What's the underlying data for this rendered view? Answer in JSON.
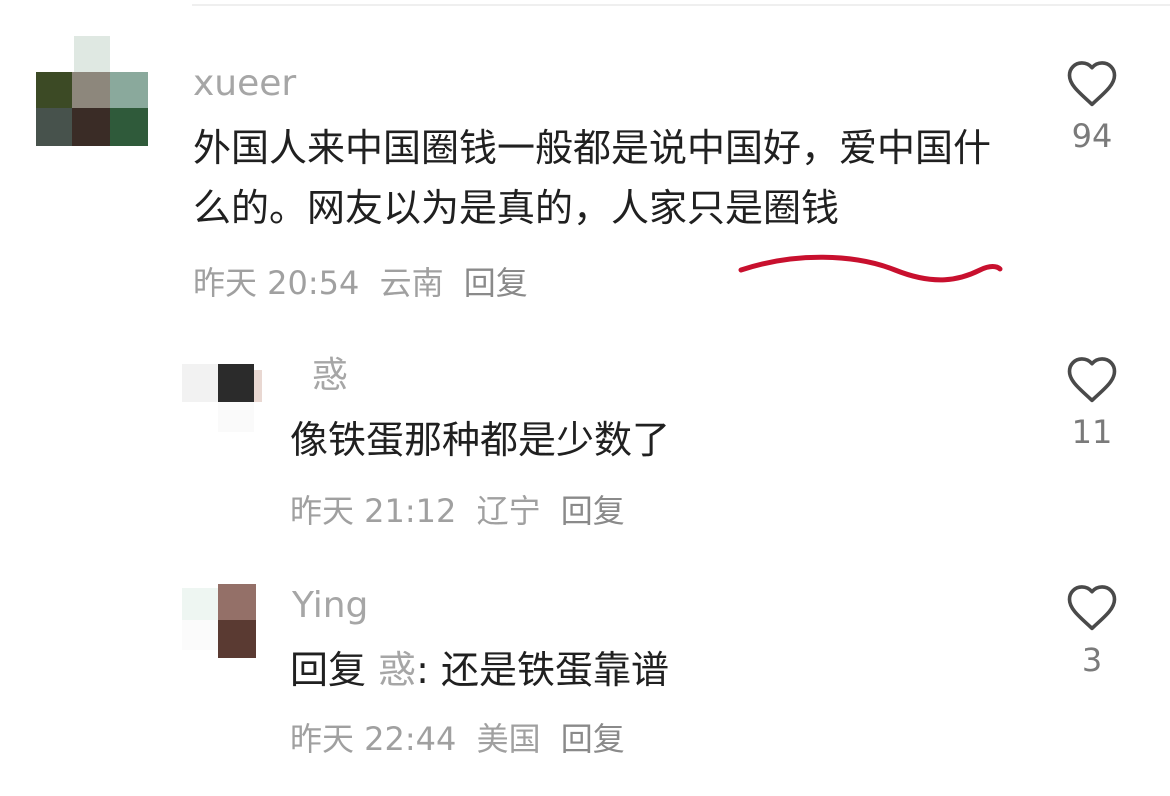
{
  "comments": [
    {
      "username": "xueer",
      "text": "外国人来中国圈钱一般都是说中国好，爱中国什么的。网友以为是真的，人家只是圈钱",
      "time": "昨天 20:54",
      "location": "云南",
      "reply_label": "回复",
      "likes": "94"
    },
    {
      "username": "惑",
      "text": "像铁蛋那种都是少数了",
      "time": "昨天 21:12",
      "location": "辽宁",
      "reply_label": "回复",
      "likes": "11"
    },
    {
      "username": "Ying",
      "reply_prefix": "回复",
      "reply_to": "惑",
      "text": ": 还是铁蛋靠谱",
      "time": "昨天 22:44",
      "location": "美国",
      "reply_label": "回复",
      "likes": "3"
    }
  ],
  "colors": {
    "underline": "#c8102e",
    "username": "#a6a6a6",
    "meta": "#a0a0a0"
  },
  "icons": {
    "like": "heart-outline-icon"
  }
}
